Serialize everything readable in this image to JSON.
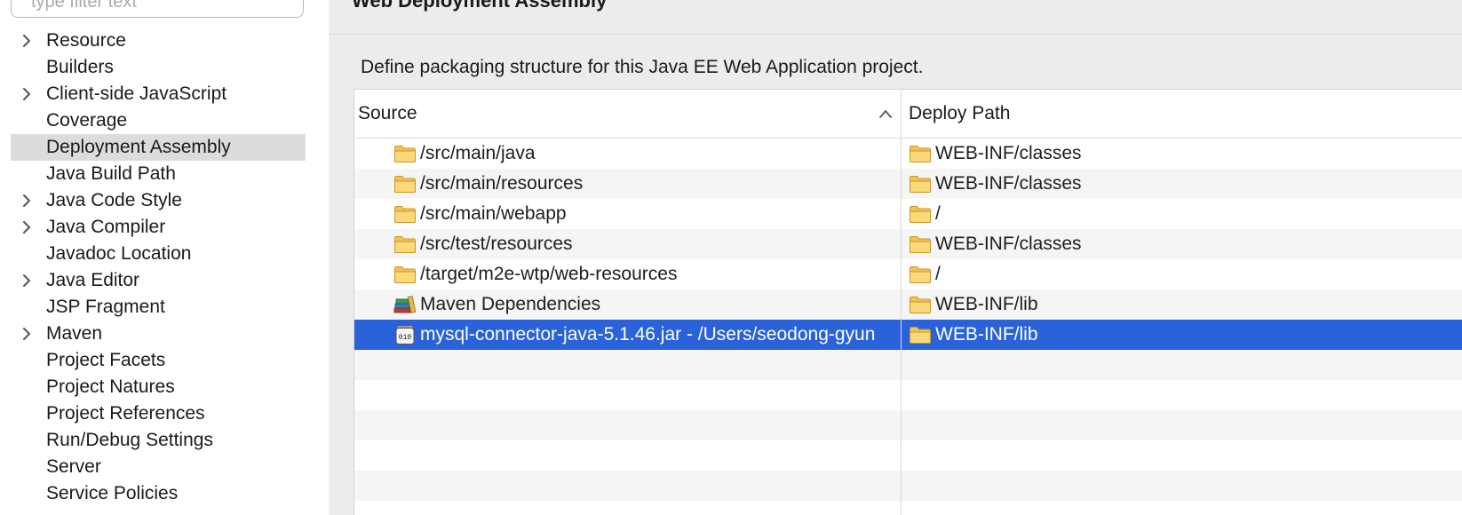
{
  "filter": {
    "placeholder": "type filter text"
  },
  "nav": {
    "items": [
      {
        "label": "Resource",
        "expandable": true
      },
      {
        "label": "Builders",
        "expandable": false
      },
      {
        "label": "Client-side JavaScript",
        "expandable": true
      },
      {
        "label": "Coverage",
        "expandable": false
      },
      {
        "label": "Deployment Assembly",
        "expandable": false,
        "selected": true
      },
      {
        "label": "Java Build Path",
        "expandable": false
      },
      {
        "label": "Java Code Style",
        "expandable": true
      },
      {
        "label": "Java Compiler",
        "expandable": true
      },
      {
        "label": "Javadoc Location",
        "expandable": false
      },
      {
        "label": "Java Editor",
        "expandable": true
      },
      {
        "label": "JSP Fragment",
        "expandable": false
      },
      {
        "label": "Maven",
        "expandable": true
      },
      {
        "label": "Project Facets",
        "expandable": false
      },
      {
        "label": "Project Natures",
        "expandable": false
      },
      {
        "label": "Project References",
        "expandable": false
      },
      {
        "label": "Run/Debug Settings",
        "expandable": false
      },
      {
        "label": "Server",
        "expandable": false
      },
      {
        "label": "Service Policies",
        "expandable": false
      }
    ]
  },
  "page": {
    "title": "Web Deployment Assembly",
    "description": "Define packaging structure for this Java EE Web Application project."
  },
  "table": {
    "columns": {
      "source": "Source",
      "deploy_path": "Deploy Path"
    },
    "sort_icon": "chevron-up-icon",
    "rows": [
      {
        "source": "/src/main/java",
        "source_icon": "folder-icon",
        "deploy": "WEB-INF/classes"
      },
      {
        "source": "/src/main/resources",
        "source_icon": "folder-icon",
        "deploy": "WEB-INF/classes"
      },
      {
        "source": "/src/main/webapp",
        "source_icon": "folder-icon",
        "deploy": "/"
      },
      {
        "source": "/src/test/resources",
        "source_icon": "folder-icon",
        "deploy": "WEB-INF/classes"
      },
      {
        "source": "/target/m2e-wtp/web-resources",
        "source_icon": "folder-icon",
        "deploy": "/"
      },
      {
        "source": "Maven Dependencies",
        "source_icon": "library-icon",
        "deploy": "WEB-INF/lib"
      },
      {
        "source": "mysql-connector-java-5.1.46.jar - /Users/seodong-gyun",
        "source_icon": "jar-icon",
        "deploy": "WEB-INF/lib",
        "selected": true
      }
    ]
  },
  "colors": {
    "selection": "#2962d9",
    "nav_selection": "#dcdcdc",
    "folder": "#f6c655"
  }
}
